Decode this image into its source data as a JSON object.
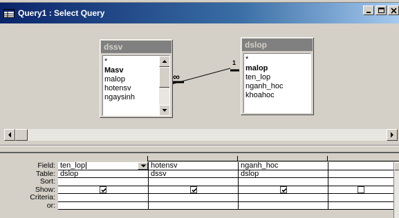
{
  "window": {
    "title": "Query1 : Select Query",
    "icon": "query-window-icon"
  },
  "tables": [
    {
      "name": "dssv",
      "fields": [
        "*",
        "Masv",
        "malop",
        "hotensv",
        "ngaysinh"
      ],
      "key_field": "Masv"
    },
    {
      "name": "dslop",
      "fields": [
        "*",
        "malop",
        "ten_lop",
        "nganh_hoc",
        "khoahoc"
      ],
      "key_field": "malop"
    }
  ],
  "relationship": {
    "one_side": "1",
    "many_side": "∞"
  },
  "grid": {
    "row_labels": [
      "Field:",
      "Table:",
      "Sort:",
      "Show:",
      "Criteria:",
      "or:"
    ],
    "columns": [
      {
        "field": "ten_lop",
        "table": "dslop",
        "sort": "",
        "show": true
      },
      {
        "field": "hotensv",
        "table": "dssv",
        "sort": "",
        "show": true
      },
      {
        "field": "nganh_hoc",
        "table": "dslop",
        "sort": "",
        "show": true
      },
      {
        "field": "",
        "table": "",
        "sort": "",
        "show": false
      }
    ]
  }
}
